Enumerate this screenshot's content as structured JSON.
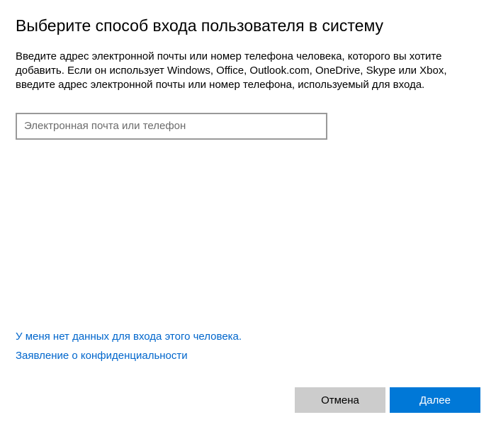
{
  "dialog": {
    "title": "Выберите способ входа пользователя в систему",
    "description": "Введите адрес электронной почты или номер телефона человека, которого вы хотите добавить. Если он использует Windows, Office, Outlook.com, OneDrive, Skype или Xbox, введите адрес электронной почты или номер телефона, используемый для входа."
  },
  "input": {
    "placeholder": "Электронная почта или телефон",
    "value": ""
  },
  "links": {
    "no_credentials": "У меня нет данных для входа этого человека.",
    "privacy": "Заявление о конфиденциальности"
  },
  "buttons": {
    "cancel": "Отмена",
    "next": "Далее"
  },
  "colors": {
    "accent": "#0078d7",
    "link": "#0066cc",
    "secondary_button": "#cccccc",
    "border": "#999999"
  }
}
